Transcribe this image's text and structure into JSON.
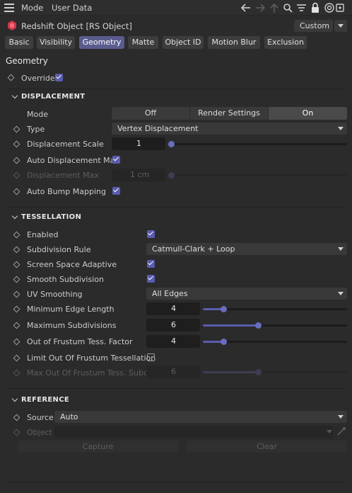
{
  "menu": {
    "mode": "Mode",
    "user_data": "User Data"
  },
  "object": {
    "title": "Redshift Object [RS Object]",
    "preset": "Custom"
  },
  "tabs": [
    "Basic",
    "Visibility",
    "Geometry",
    "Matte",
    "Object ID",
    "Motion Blur",
    "Exclusion"
  ],
  "section_title": "Geometry",
  "override": {
    "label": "Override",
    "checked": true
  },
  "displacement": {
    "header": "DISPLACEMENT",
    "mode_label": "Mode",
    "mode_options": [
      "Off",
      "Render Settings",
      "On"
    ],
    "mode_selected": "On",
    "type_label": "Type",
    "type_value": "Vertex Displacement",
    "scale_label": "Displacement Scale",
    "scale_value": "1",
    "auto_max_label": "Auto Displacement Max",
    "max_label": "Displacement Max",
    "max_value": "1 cm",
    "auto_bump_label": "Auto Bump Mapping"
  },
  "tessellation": {
    "header": "TESSELLATION",
    "enabled_label": "Enabled",
    "rule_label": "Subdivision Rule",
    "rule_value": "Catmull-Clark + Loop",
    "screen_label": "Screen Space Adaptive",
    "smooth_label": "Smooth Subdivision",
    "uv_label": "UV Smoothing",
    "uv_value": "All Edges",
    "min_edge_label": "Minimum Edge Length",
    "min_edge_value": "4",
    "max_sub_label": "Maximum Subdivisions",
    "max_sub_value": "6",
    "oof_label": "Out of Frustum Tess. Factor",
    "oof_value": "4",
    "limit_label": "Limit Out Of Frustum Tessellation",
    "max_oof_label": "Max Out Of Frustum Tess. Subdivs",
    "max_oof_value": "6"
  },
  "reference": {
    "header": "REFERENCE",
    "source_label": "Source",
    "source_value": "Auto",
    "object_label": "Object",
    "capture_label": "Capture",
    "clear_label": "Clear"
  },
  "colors": {
    "accent": "#5a5cb0",
    "background": "#2b2b2b",
    "active_tab": "#5a5c8e"
  }
}
